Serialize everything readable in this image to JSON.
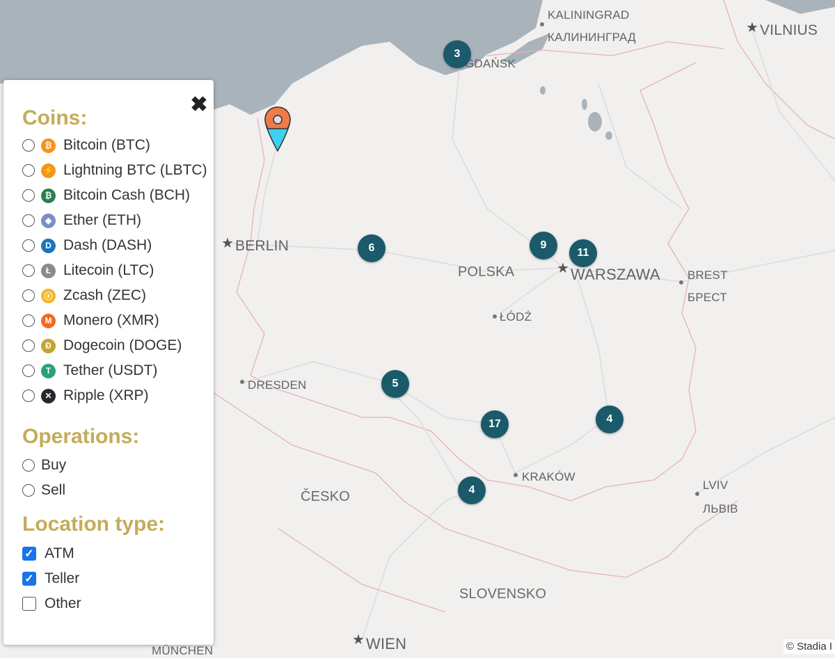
{
  "map": {
    "places": [
      {
        "id": "kaliningrad",
        "label": "KALININGRAD"
      },
      {
        "id": "kaliningrad_cyr",
        "label": "КАЛИНИНГРАД"
      },
      {
        "id": "vilnius",
        "label": "VILNIUS"
      },
      {
        "id": "gdansk",
        "label": "GDAŃSK"
      },
      {
        "id": "berlin",
        "label": "BERLIN"
      },
      {
        "id": "polska",
        "label": "POLSKA"
      },
      {
        "id": "warszawa",
        "label": "WARSZAWA"
      },
      {
        "id": "brest",
        "label": "BREST"
      },
      {
        "id": "brest_cyr",
        "label": "БРЕСТ"
      },
      {
        "id": "lodz",
        "label": "ŁÓDŹ"
      },
      {
        "id": "dresden",
        "label": "DRESDEN"
      },
      {
        "id": "krakow",
        "label": "KRAKÓW"
      },
      {
        "id": "cesko",
        "label": "ČESKO"
      },
      {
        "id": "lviv",
        "label": "LVIV"
      },
      {
        "id": "lviv_cyr",
        "label": "ЛЬВІВ"
      },
      {
        "id": "slovensko",
        "label": "SLOVENSKO"
      },
      {
        "id": "wien",
        "label": "WIEN"
      },
      {
        "id": "munchen",
        "label": "MÜNCHEN"
      }
    ],
    "clusters": [
      "3",
      "6",
      "9",
      "11",
      "5",
      "17",
      "4",
      "4"
    ],
    "attribution": "© Stadia I"
  },
  "panel": {
    "coins_title": "Coins:",
    "coins": [
      {
        "label": "Bitcoin (BTC)",
        "icon": "bitcoin-icon",
        "glyph": "₿",
        "color": "#f7931a"
      },
      {
        "label": "Lightning BTC (LBTC)",
        "icon": "lightning-icon",
        "glyph": "⚡",
        "color": "#f7931a"
      },
      {
        "label": "Bitcoin Cash (BCH)",
        "icon": "bitcoin-cash-icon",
        "glyph": "₿",
        "color": "#2e7d4f"
      },
      {
        "label": "Ether (ETH)",
        "icon": "ether-icon",
        "glyph": "◆",
        "color": "#7b8fc7"
      },
      {
        "label": "Dash (DASH)",
        "icon": "dash-icon",
        "glyph": "D",
        "color": "#1c75bc"
      },
      {
        "label": "Litecoin (LTC)",
        "icon": "litecoin-icon",
        "glyph": "Ł",
        "color": "#8a8a8a"
      },
      {
        "label": "Zcash (ZEC)",
        "icon": "zcash-icon",
        "glyph": "ⓩ",
        "color": "#f4b728"
      },
      {
        "label": "Monero (XMR)",
        "icon": "monero-icon",
        "glyph": "M",
        "color": "#f26822"
      },
      {
        "label": "Dogecoin (DOGE)",
        "icon": "dogecoin-icon",
        "glyph": "Ð",
        "color": "#c2a633"
      },
      {
        "label": "Tether (USDT)",
        "icon": "tether-icon",
        "glyph": "T",
        "color": "#26a17b"
      },
      {
        "label": "Ripple (XRP)",
        "icon": "ripple-icon",
        "glyph": "✕",
        "color": "#23292f"
      }
    ],
    "operations_title": "Operations:",
    "operations": [
      "Buy",
      "Sell"
    ],
    "location_title": "Location type:",
    "locations": [
      {
        "label": "ATM",
        "checked": true
      },
      {
        "label": "Teller",
        "checked": true
      },
      {
        "label": "Other",
        "checked": false
      }
    ],
    "close_glyph": "✖"
  },
  "colors": {
    "cluster": "#1a5a6a",
    "accent": "#c4ac5a",
    "sea": "#a8b2ba",
    "pin_top": "#f07a4a",
    "pin_bottom": "#3ed0f0"
  }
}
